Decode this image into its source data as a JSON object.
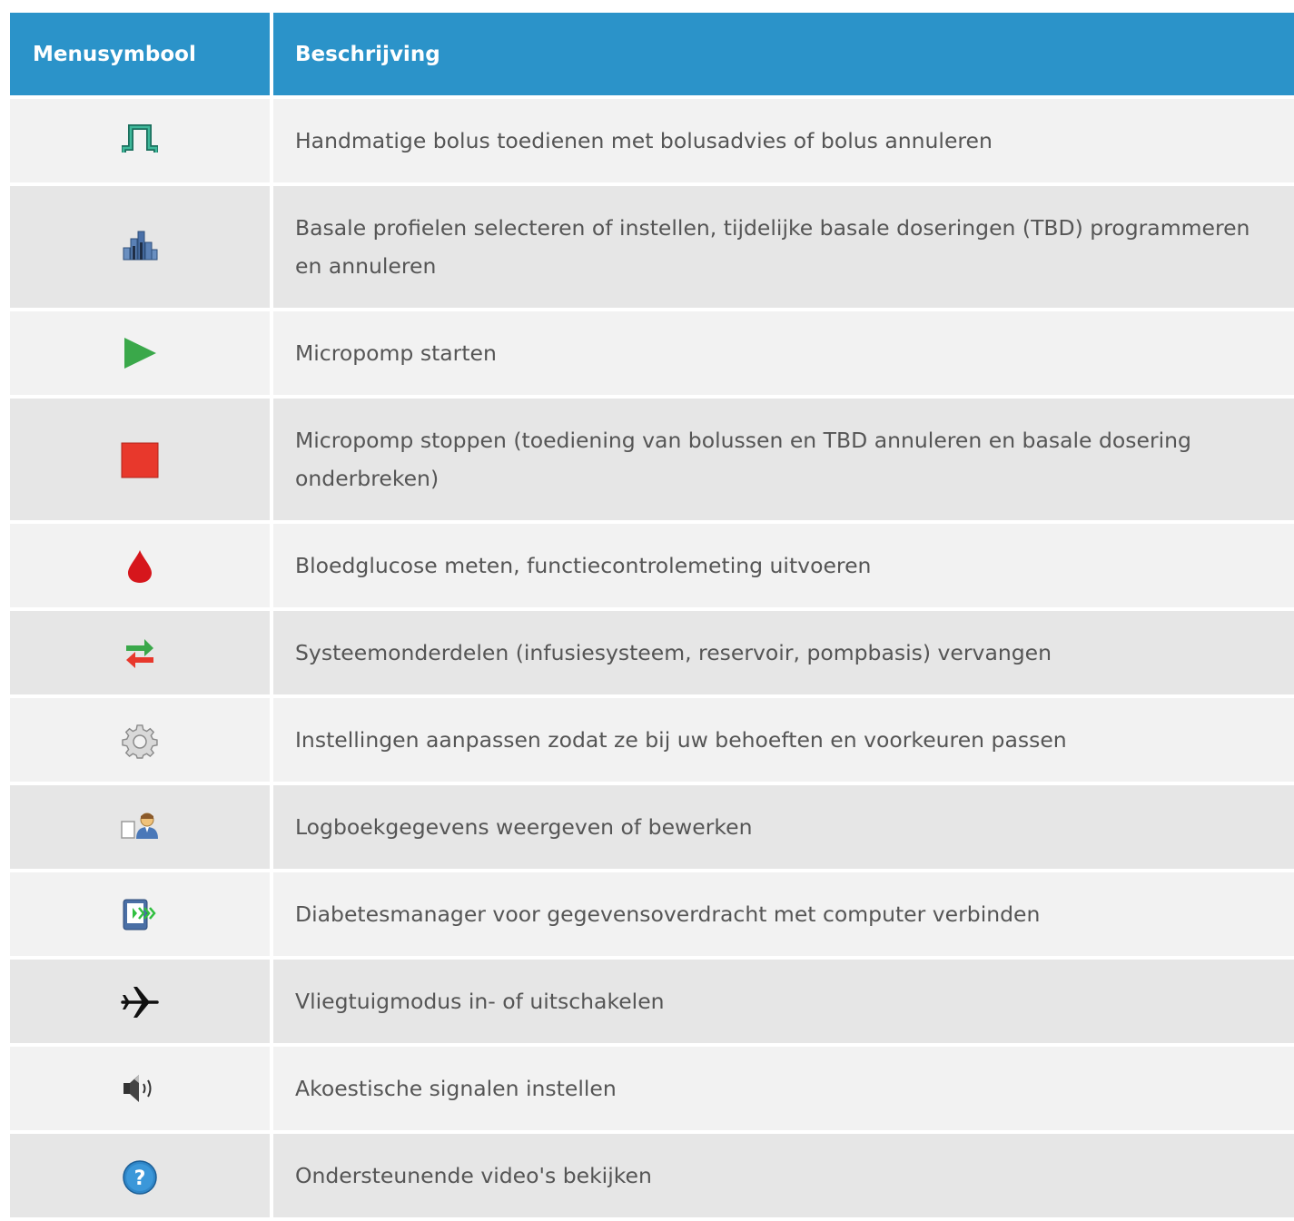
{
  "header": {
    "col_symbol": "Menusymbool",
    "col_description": "Beschrijving"
  },
  "rows": [
    {
      "icon": "bolus-icon",
      "description": "Handmatige bolus toedienen met bolusadvies of bolus annuleren"
    },
    {
      "icon": "basal-profile-icon",
      "description": "Basale profielen selecteren of instellen, tijdelijke basale doseringen (TBD) programmeren en annuleren"
    },
    {
      "icon": "play-icon",
      "description": "Micropomp starten"
    },
    {
      "icon": "stop-icon",
      "description": "Micropomp stoppen (toediening van bolussen en TBD annuleren en basale dosering onderbreken)"
    },
    {
      "icon": "blood-drop-icon",
      "description": "Bloedglucose meten, functiecontrolemeting uitvoeren"
    },
    {
      "icon": "exchange-arrows-icon",
      "description": "Systeemonderdelen (infusiesysteem, reservoir, pompbasis) vervangen"
    },
    {
      "icon": "gear-icon",
      "description": "Instellingen aanpassen zodat ze bij uw behoeften en voorkeuren passen"
    },
    {
      "icon": "logbook-icon",
      "description": "Logboekgegevens weergeven of bewerken"
    },
    {
      "icon": "data-transfer-icon",
      "description": "Diabetesmanager voor gegevensoverdracht met computer verbinden"
    },
    {
      "icon": "airplane-icon",
      "description": "Vliegtuigmodus in- of uitschakelen"
    },
    {
      "icon": "speaker-icon",
      "description": "Akoestische signalen instellen"
    },
    {
      "icon": "help-icon",
      "description": "Ondersteunende video's bekijken"
    }
  ],
  "colors": {
    "header_bg": "#2b93c9",
    "row_light": "#f2f2f2",
    "row_dark": "#e6e6e6",
    "text": "#555555"
  }
}
